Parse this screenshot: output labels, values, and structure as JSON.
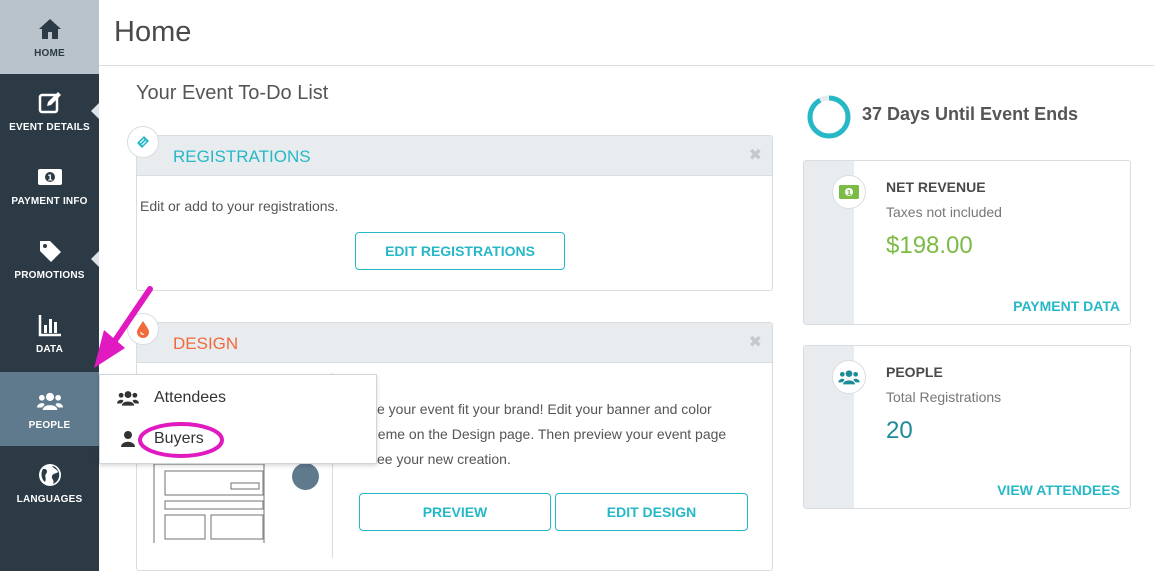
{
  "sidebar": {
    "items": [
      {
        "label": "HOME",
        "icon": "home-icon"
      },
      {
        "label": "EVENT DETAILS",
        "icon": "edit-icon"
      },
      {
        "label": "PAYMENT INFO",
        "icon": "money-icon"
      },
      {
        "label": "PROMOTIONS",
        "icon": "tag-icon"
      },
      {
        "label": "DATA",
        "icon": "bar-chart-icon"
      },
      {
        "label": "PEOPLE",
        "icon": "people-icon"
      },
      {
        "label": "LANGUAGES",
        "icon": "globe-icon"
      }
    ]
  },
  "header": {
    "title": "Home"
  },
  "todo": {
    "title": "Your Event To-Do List",
    "registrations": {
      "title": "REGISTRATIONS",
      "description": "Edit or add to your registrations.",
      "button": "EDIT REGISTRATIONS",
      "close": "✖"
    },
    "design": {
      "title": "DESIGN",
      "description_lines": [
        "ke your event fit your brand! Edit your banner and color",
        "heme on the Design page. Then preview your event page",
        "see your new creation."
      ],
      "preview_button": "PREVIEW",
      "edit_button": "EDIT DESIGN",
      "close": "✖"
    }
  },
  "countdown": {
    "text": "37 Days Until Event Ends"
  },
  "revenue": {
    "title": "NET REVENUE",
    "subtitle": "Taxes not included",
    "value": "$198.00",
    "link": "PAYMENT DATA"
  },
  "people": {
    "title": "PEOPLE",
    "subtitle": "Total Registrations",
    "value": "20",
    "link": "VIEW ATTENDEES"
  },
  "popup": {
    "items": [
      {
        "label": "Attendees",
        "icon": "group-icon"
      },
      {
        "label": "Buyers",
        "icon": "user-icon"
      }
    ]
  },
  "colors": {
    "sidebar": "#2b3a45",
    "accent": "#27b8c8",
    "design": "#f06a3b",
    "revenue": "#7cbb45",
    "people_value": "#1f8a99",
    "annotation": "#e01ac0"
  }
}
